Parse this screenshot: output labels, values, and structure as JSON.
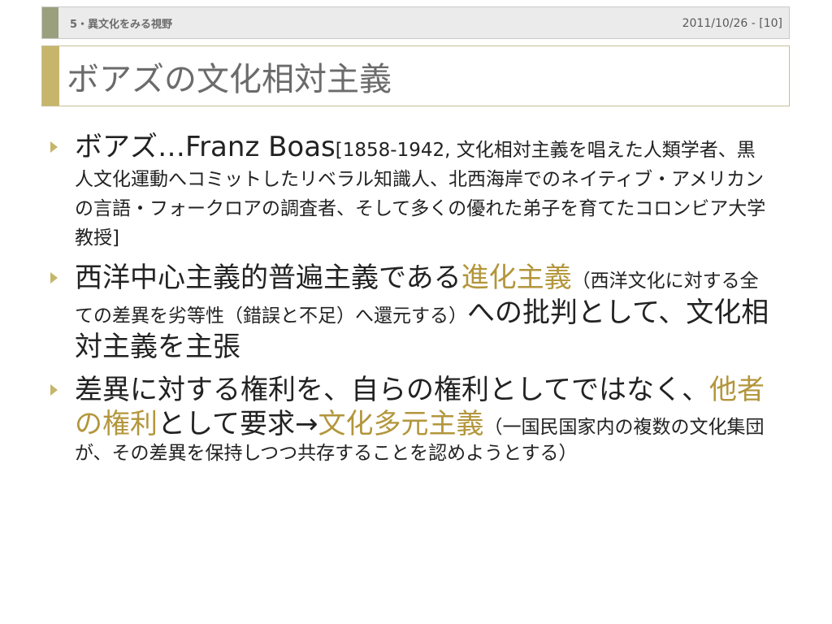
{
  "header": {
    "section": "5・異文化をみる視野",
    "date_page": "2011/10/26 - [10]"
  },
  "title": "ボアズの文化相対主義",
  "bullets": [
    {
      "main": "ボアズ…Franz Boas",
      "note": "[1858-1942, 文化相対主義を唱えた人類学者、黒人文化運動へコミットしたリベラル知識人、北西海岸でのネイティブ・アメリカンの言語・フォークロアの調査者、そして多くの優れた弟子を育てたコロンビア大学教授]"
    },
    {
      "part1": "西洋中心主義的普遍主義である",
      "highlight": "進化主義",
      "paren": "（西洋文化に対する全ての差異を劣等性（錯誤と不足）へ還元する）",
      "part2": "への批判として、文化相対主義を主張"
    },
    {
      "part1": "差異に対する権利を、自らの権利としてではなく、",
      "highlight1": "他者の権利",
      "part2": "として要求→",
      "highlight2": "文化多元主義",
      "paren": "（一国民国家内の複数の文化集団が、その差異を保持しつつ共存することを認めようとする）"
    }
  ],
  "colors": {
    "accent_gold": "#c7b56b",
    "accent_olive": "#9aa07e",
    "highlight_text": "#b3963c"
  }
}
